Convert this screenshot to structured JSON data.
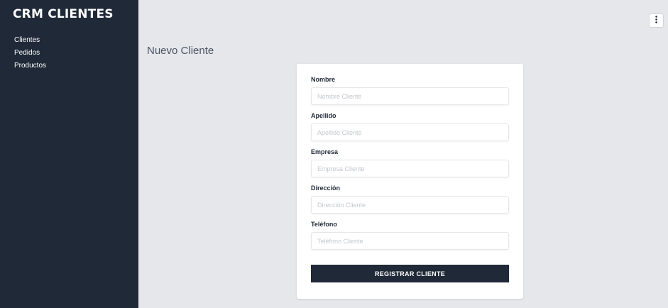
{
  "sidebar": {
    "brand": "CRM CLIENTES",
    "items": [
      {
        "label": "Clientes"
      },
      {
        "label": "Pedidos"
      },
      {
        "label": "Productos"
      }
    ]
  },
  "header": {
    "menu_icon": "kebab-vertical-icon",
    "menu_glyph": "⋮"
  },
  "main": {
    "title": "Nuevo Cliente"
  },
  "form": {
    "fields": [
      {
        "label": "Nombre",
        "placeholder": "Nombre Cliente",
        "value": ""
      },
      {
        "label": "Apellido",
        "placeholder": "Apellido Cliente",
        "value": ""
      },
      {
        "label": "Empresa",
        "placeholder": "Empresa Cliente",
        "value": ""
      },
      {
        "label": "Dirección",
        "placeholder": "Dirección Cliente",
        "value": ""
      },
      {
        "label": "Teléfono",
        "placeholder": "Teléfono Cliente",
        "value": ""
      }
    ],
    "submit_label": "REGISTRAR CLIENTE"
  },
  "colors": {
    "sidebar_bg": "#1f2937",
    "page_bg": "#e5e7eb",
    "button_bg": "#1f2937",
    "card_bg": "#ffffff"
  }
}
